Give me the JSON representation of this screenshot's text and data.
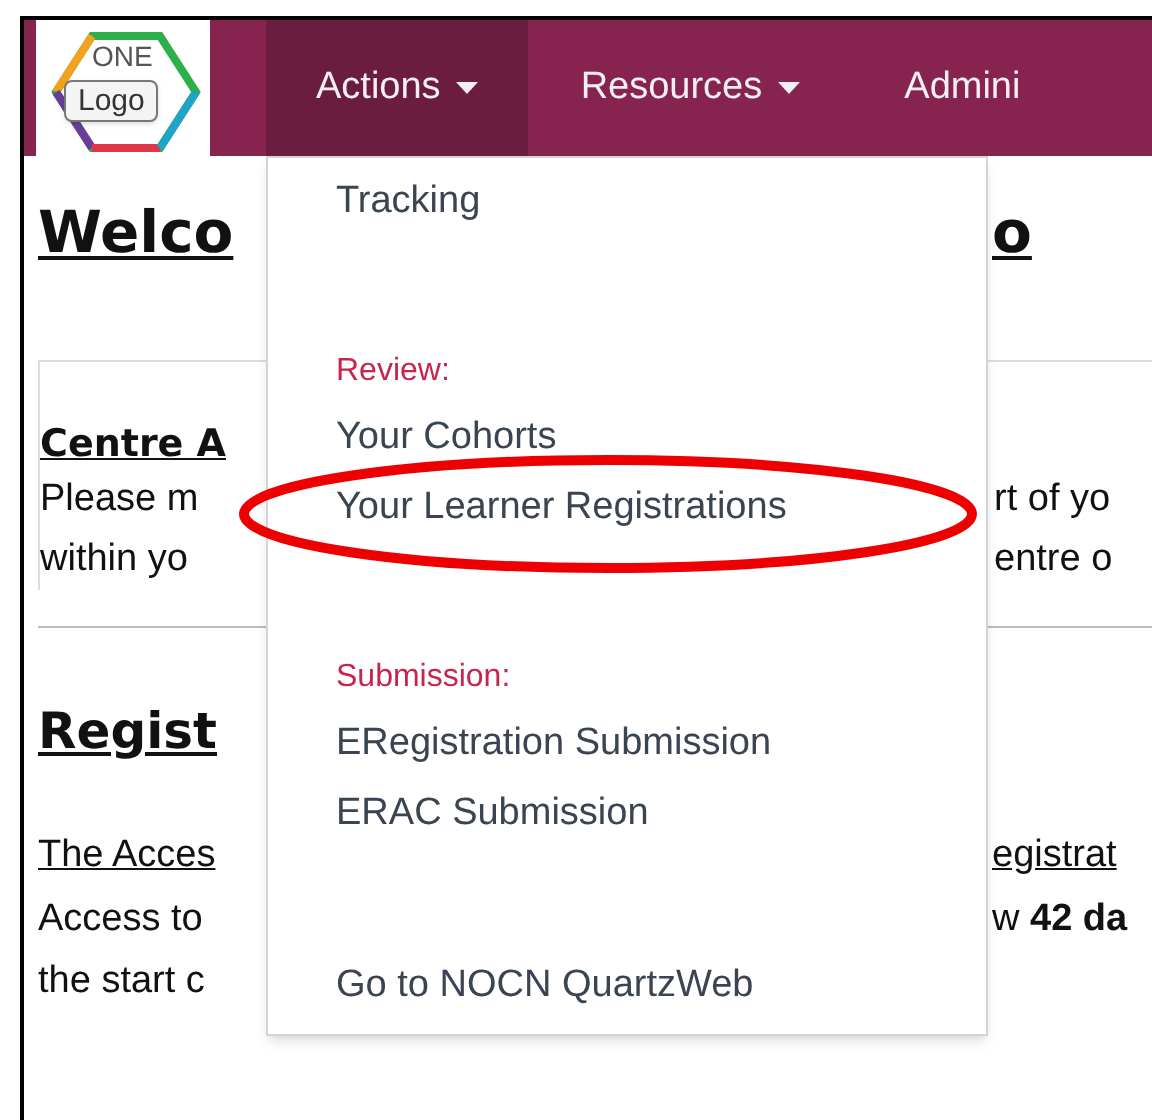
{
  "logo": {
    "word": "ONE",
    "label": "Logo"
  },
  "nav": [
    {
      "label": "Actions",
      "caret": true,
      "selected": true
    },
    {
      "label": "Resources",
      "caret": true,
      "selected": false
    },
    {
      "label": "Admini",
      "caret": false,
      "selected": false
    }
  ],
  "menu": [
    {
      "items": [
        "Tracking"
      ]
    },
    {
      "header": "Review:",
      "items": [
        "Your Cohorts",
        "Your Learner Registrations"
      ]
    },
    {
      "header": "Submission:",
      "items": [
        "ERegistration Submission",
        "ERAC Submission"
      ]
    },
    {
      "items": [
        "Go to NOCN QuartzWeb"
      ]
    }
  ],
  "title": {
    "left": "Welco",
    "right": "o"
  },
  "panel": {
    "heading": "Centre A",
    "lines": [
      {
        "left": "Please m",
        "right": "rt of yo"
      },
      {
        "left": "within yo",
        "right": "entre o"
      }
    ]
  },
  "section": {
    "heading": "Regist",
    "link": {
      "left": "The Acces",
      "right": "egistrat"
    },
    "lines": [
      {
        "left": "Access to",
        "right": "w **42 da**"
      },
      {
        "left": "the start c"
      }
    ]
  }
}
